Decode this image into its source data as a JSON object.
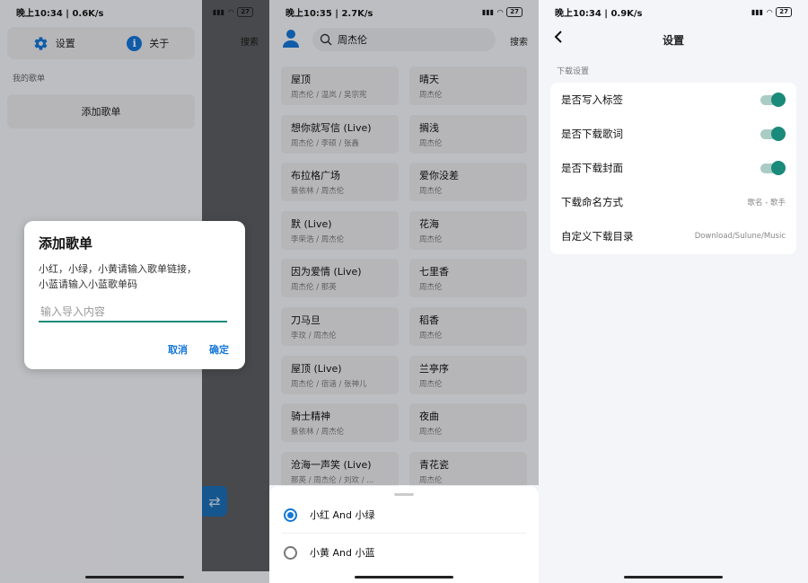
{
  "panel1": {
    "status": {
      "time": "晚上10:34 | 0.6K/s",
      "battery": "27"
    },
    "drawer": {
      "settings_label": "设置",
      "about_label": "关于",
      "my_playlists_label": "我的歌单",
      "add_playlist_label": "添加歌单"
    },
    "background": {
      "search_label": "搜索"
    },
    "dialog": {
      "title": "添加歌单",
      "message_line1": "小红，小绿，小黄请输入歌单链接，",
      "message_line2": "小蓝请输入小蓝歌单码",
      "input_placeholder": "输入导入内容",
      "input_value": "",
      "cancel_label": "取消",
      "confirm_label": "确定"
    }
  },
  "panel2": {
    "status": {
      "time": "晚上10:35 | 2.7K/s",
      "battery": "27"
    },
    "search": {
      "query": "周杰伦",
      "button_label": "搜索"
    },
    "songs": [
      {
        "title": "屋顶",
        "artist": "周杰伦 / 温岚 / 吴宗宪"
      },
      {
        "title": "晴天",
        "artist": "周杰伦"
      },
      {
        "title": "想你就写信 (Live)",
        "artist": "周杰伦 / 李硕 / 张鑫"
      },
      {
        "title": "搁浅",
        "artist": "周杰伦"
      },
      {
        "title": "布拉格广场",
        "artist": "蔡依林 / 周杰伦"
      },
      {
        "title": "爱你没差",
        "artist": "周杰伦"
      },
      {
        "title": "默 (Live)",
        "artist": "李荣浩 / 周杰伦"
      },
      {
        "title": "花海",
        "artist": "周杰伦"
      },
      {
        "title": "因为爱情 (Live)",
        "artist": "周杰伦 / 那英"
      },
      {
        "title": "七里香",
        "artist": "周杰伦"
      },
      {
        "title": "刀马旦",
        "artist": "李玟 / 周杰伦"
      },
      {
        "title": "稻香",
        "artist": "周杰伦"
      },
      {
        "title": "屋顶 (Live)",
        "artist": "周杰伦 / 宿涵 / 张神儿"
      },
      {
        "title": "兰亭序",
        "artist": "周杰伦"
      },
      {
        "title": "骑士精神",
        "artist": "蔡依林 / 周杰伦"
      },
      {
        "title": "夜曲",
        "artist": "周杰伦"
      },
      {
        "title": "沧海一声笑 (Live)",
        "artist": "那英 / 周杰伦 / 刘欢 / ..."
      },
      {
        "title": "青花瓷",
        "artist": "周杰伦"
      }
    ],
    "sheet": {
      "option1": "小红 And 小绿",
      "option2": "小黄 And 小蓝",
      "selected": "option1"
    }
  },
  "panel3": {
    "status": {
      "time": "晚上10:34 | 0.9K/s",
      "battery": "27"
    },
    "title": "设置",
    "section_label": "下载设置",
    "rows": [
      {
        "label": "是否写入标签",
        "toggle": true
      },
      {
        "label": "是否下载歌词",
        "toggle": true
      },
      {
        "label": "是否下载封面",
        "toggle": true
      },
      {
        "label": "下载命名方式",
        "value": "歌名 - 歌手"
      },
      {
        "label": "自定义下载目录",
        "value": "Download/Sulune/Music"
      }
    ]
  },
  "colors": {
    "accent_blue": "#1577d8",
    "toggle_green": "#1a8a7a",
    "dim_bg": "#5b5e62"
  }
}
